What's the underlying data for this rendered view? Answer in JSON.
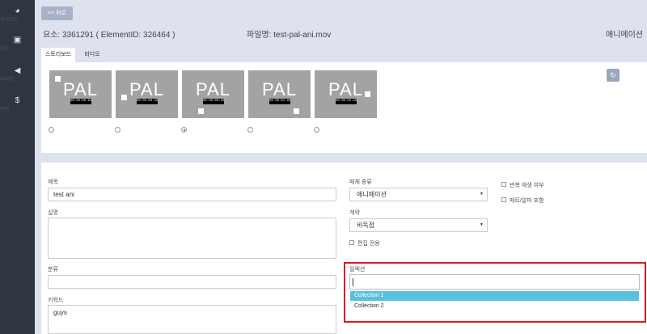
{
  "sidebar": {
    "items": [
      {
        "icon": "dashboard-icon",
        "glyph": "◕",
        "label": "대시보드"
      },
      {
        "icon": "assets-icon",
        "glyph": "▣",
        "label": "자산"
      },
      {
        "icon": "marketing-icon",
        "glyph": "◀",
        "label": "마케팅"
      },
      {
        "icon": "dollar-icon",
        "glyph": "$",
        "label": "판매"
      }
    ]
  },
  "header": {
    "back_label": "<< 뒤로",
    "element_info": "요소: 3361291 ( ElementID: 326464 )",
    "file_info": "파일명: test-pal-ani.mov",
    "type_label": "애니메이션"
  },
  "tabs": [
    {
      "label": "스토리보드",
      "active": true
    },
    {
      "label": "비디오",
      "active": false
    }
  ],
  "storyboard": {
    "thumbnails": [
      {
        "text": "PAL",
        "timecode": "00:00:00:01"
      },
      {
        "text": "PAL",
        "timecode": "00:00:00:10"
      },
      {
        "text": "PAL",
        "timecode": "00:00:00:20"
      },
      {
        "text": "PAL",
        "timecode": "00:00:01:05"
      },
      {
        "text": "PAL",
        "timecode": "00:00:01:15"
      }
    ],
    "selected_index": 2,
    "refresh_icon": "refresh-icon"
  },
  "form": {
    "title_label": "제목",
    "title_value": "test ani",
    "desc_label": "설명",
    "desc_value": "",
    "category_label": "분류",
    "category_value": "",
    "keywords_label": "키워드",
    "keywords_value": "guys",
    "media_type_label": "매체 종류",
    "media_type_value": "애니메이션",
    "contract_label": "계약",
    "contract_value": "비독점",
    "editorial_label": "편집 전용",
    "loop_label": "반복 재생 여부",
    "matte_label": "매트/알파 포함",
    "collection_label": "컬렉션",
    "collection_value": "",
    "collection_options": [
      "Collection 1",
      "Collection 2"
    ],
    "highlighted_option": "Collection 1"
  },
  "colors": {
    "sidebar_bg": "#2f3640",
    "page_bg": "#dde2ee",
    "highlight_border": "#e0161e",
    "option_selected": "#5bc0de"
  }
}
